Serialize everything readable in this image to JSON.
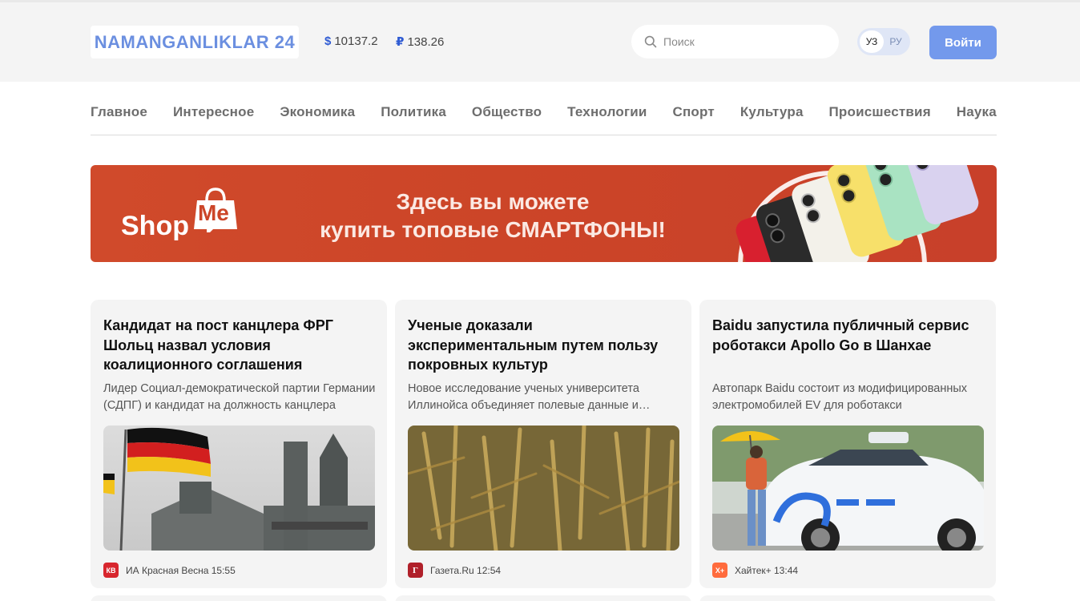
{
  "header": {
    "logo_text": "NAMANGANLIKLAR 24",
    "rates": [
      {
        "symbol": "$",
        "value": "10137.2"
      },
      {
        "symbol": "₽",
        "value": "138.26"
      }
    ],
    "search": {
      "placeholder": "Поиск",
      "value": ""
    },
    "languages": [
      {
        "label": "УЗ",
        "active": true
      },
      {
        "label": "РУ",
        "active": false
      }
    ],
    "login_label": "Войти"
  },
  "nav": {
    "items": [
      "Главное",
      "Интересное",
      "Экономика",
      "Политика",
      "Общество",
      "Технологии",
      "Спорт",
      "Культура",
      "Происшествия",
      "Наука"
    ]
  },
  "banner": {
    "brand_left": "Shop",
    "brand_right": "Me",
    "line1": "Здесь вы можете",
    "line2": "купить топовые СМАРТФОНЫ!"
  },
  "articles": [
    {
      "title": "Кандидат на пост канцлера ФРГ Шольц назвал условия коалиционного соглашения",
      "summary": "Лидер Социал-демократической партии Германии (СДПГ) и кандидат на должность канцлера",
      "source_badge": "КВ",
      "source": "ИА Красная Весна 15:55",
      "image": "reichstag-with-german-flag"
    },
    {
      "title": "Ученые доказали экспериментальным путем пользу покровных культур",
      "summary": "Новое исследование ученых университета Иллинойса объединяет полевые данные и моделирование",
      "source_badge": "Г",
      "source": "Газета.Ru 12:54",
      "image": "wheat-field"
    },
    {
      "title": "Baidu запустила публичный сервис роботакси Apollo Go в Шанхае",
      "summary": "Автопарк Baidu состоит из модифицированных электромобилей EV для роботакси",
      "source_badge": "Х+",
      "source": "Хайтек+ 13:44",
      "image": "apollo-robotaxi-car"
    }
  ],
  "colors": {
    "accent": "#7399ec",
    "logo": "#6b8fe0",
    "banner": "#cc4528",
    "header_bg": "#f4f4f4",
    "card_bg": "#f4f4f4"
  }
}
